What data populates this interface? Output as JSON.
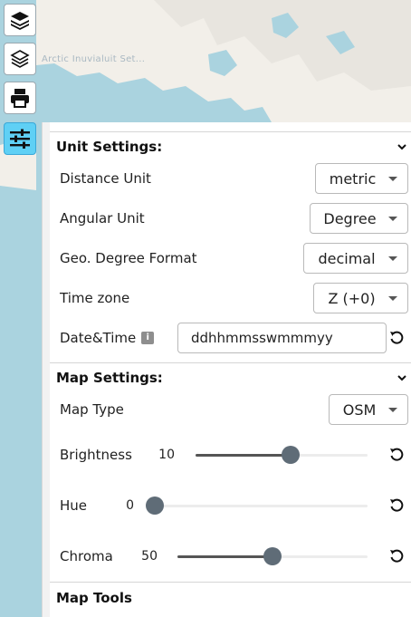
{
  "map": {
    "label": "Arctic Inuvialuit Set..."
  },
  "toolbar": {
    "items": [
      {
        "name": "layers-button",
        "icon": "layers-icon"
      },
      {
        "name": "layers-outline-button",
        "icon": "layers-outline-icon"
      },
      {
        "name": "print-button",
        "icon": "printer-icon"
      },
      {
        "name": "settings-button",
        "icon": "sliders-icon",
        "active": true
      }
    ]
  },
  "unit_settings": {
    "title": "Unit Settings:",
    "distance_unit": {
      "label": "Distance Unit",
      "value": "metric"
    },
    "angular_unit": {
      "label": "Angular Unit",
      "value": "Degree"
    },
    "geo_degree_format": {
      "label": "Geo. Degree Format",
      "value": "decimal"
    },
    "time_zone": {
      "label": "Time zone",
      "value": "Z (+0)"
    },
    "date_time": {
      "label": "Date&Time",
      "value": "ddhhmmsswmmmyy"
    }
  },
  "map_settings": {
    "title": "Map Settings:",
    "map_type": {
      "label": "Map Type",
      "value": "OSM"
    },
    "brightness": {
      "label": "Brightness",
      "value": "10",
      "fraction": 0.55
    },
    "hue": {
      "label": "Hue",
      "value": "0",
      "fraction": 0.0
    },
    "chroma": {
      "label": "Chroma",
      "value": "50",
      "fraction": 0.5
    }
  },
  "map_tools": {
    "title": "Map Tools"
  },
  "colors": {
    "active_tool": "#5fd0f5",
    "water": "#aad3df",
    "land": "#f2efe9"
  }
}
